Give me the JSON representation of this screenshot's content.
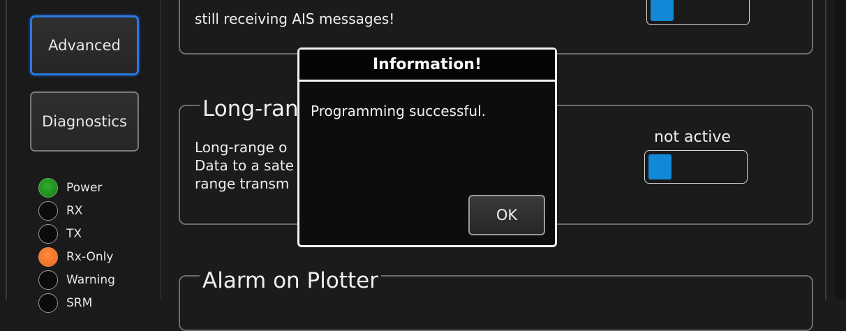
{
  "sidebar": {
    "buttons": [
      {
        "label": "Advanced",
        "active": true
      },
      {
        "label": "Diagnostics",
        "active": false
      }
    ],
    "indicators": [
      {
        "label": "Power",
        "state": "green"
      },
      {
        "label": "RX",
        "state": "off"
      },
      {
        "label": "TX",
        "state": "off"
      },
      {
        "label": "Rx-Only",
        "state": "orange"
      },
      {
        "label": "Warning",
        "state": "off"
      },
      {
        "label": "SRM",
        "state": "off"
      }
    ]
  },
  "sections": {
    "top": {
      "text": "still receiving AIS messages!"
    },
    "long_range": {
      "title": "Long-range",
      "lines": [
        "Long-range o",
        "Data to a sate",
        "range transm"
      ],
      "status": "not active"
    },
    "alarm": {
      "title": "Alarm on Plotter"
    }
  },
  "dialog": {
    "title": "Information!",
    "message": "Programming successful.",
    "ok_label": "OK"
  },
  "colors": {
    "accent": "#2a79e3",
    "toggle_knob": "#1388d6",
    "led_green": "#1f9a1f",
    "led_orange": "#f07a2a",
    "background": "#1b1b1b"
  }
}
